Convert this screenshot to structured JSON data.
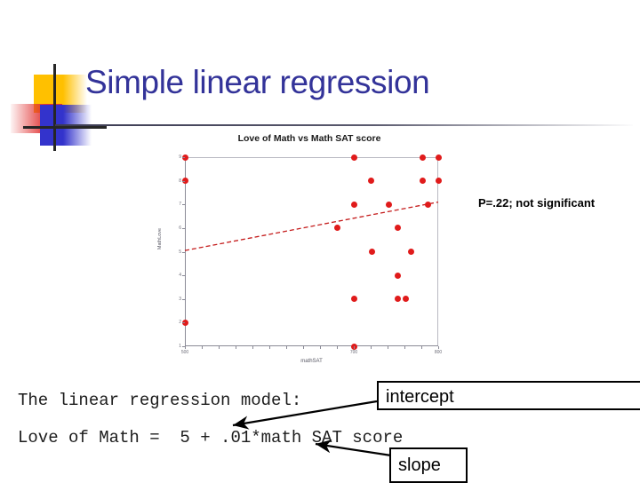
{
  "slide": {
    "title": "Simple linear regression",
    "title_color": "#333399",
    "logo": {
      "yellow": "#FFC000",
      "red": "#E03030",
      "blue": "#3333CC",
      "cross": "#262626"
    }
  },
  "annotation": {
    "pvalue_note": "P=.22; not significant"
  },
  "model": {
    "intro_line": "The linear regression model:",
    "equation_line": "Love of Math =  5 + .01*math SAT score",
    "intercept_label": "intercept",
    "slope_label": "slope"
  },
  "chart_data": {
    "type": "scatter",
    "title": "Love of Math vs Math SAT score",
    "xlabel": "mathSAT",
    "ylabel": "MathLove",
    "xlim": [
      500,
      800
    ],
    "ylim": [
      1,
      9
    ],
    "xticks": [
      500,
      700,
      800
    ],
    "xtick_labels": [
      "500",
      "700",
      "800"
    ],
    "yticks": [
      1,
      2,
      3,
      4,
      5,
      6,
      7,
      8,
      9
    ],
    "ytick_labels": [
      "1",
      "2",
      "3",
      "4",
      "5",
      "6",
      "7",
      "8",
      "9"
    ],
    "grid": false,
    "legend": null,
    "point_color": "#e01b1b",
    "line_color": "#c41a1a",
    "line_style": "dashed",
    "points": [
      {
        "x": 500,
        "y": 9
      },
      {
        "x": 500,
        "y": 8
      },
      {
        "x": 500,
        "y": 2
      },
      {
        "x": 680,
        "y": 6
      },
      {
        "x": 700,
        "y": 9
      },
      {
        "x": 700,
        "y": 7
      },
      {
        "x": 700,
        "y": 3
      },
      {
        "x": 700,
        "y": 1
      },
      {
        "x": 720,
        "y": 8
      },
      {
        "x": 722,
        "y": 5
      },
      {
        "x": 742,
        "y": 7
      },
      {
        "x": 752,
        "y": 6
      },
      {
        "x": 752,
        "y": 4
      },
      {
        "x": 752,
        "y": 3
      },
      {
        "x": 762,
        "y": 3
      },
      {
        "x": 768,
        "y": 5
      },
      {
        "x": 782,
        "y": 9
      },
      {
        "x": 782,
        "y": 8
      },
      {
        "x": 788,
        "y": 7
      },
      {
        "x": 800,
        "y": 9
      },
      {
        "x": 800,
        "y": 8
      }
    ],
    "fit_line": {
      "intercept": 5,
      "slope": 0.01,
      "x_start": 500,
      "y_start": 5.05,
      "x_end": 800,
      "y_end": 7.1
    }
  }
}
